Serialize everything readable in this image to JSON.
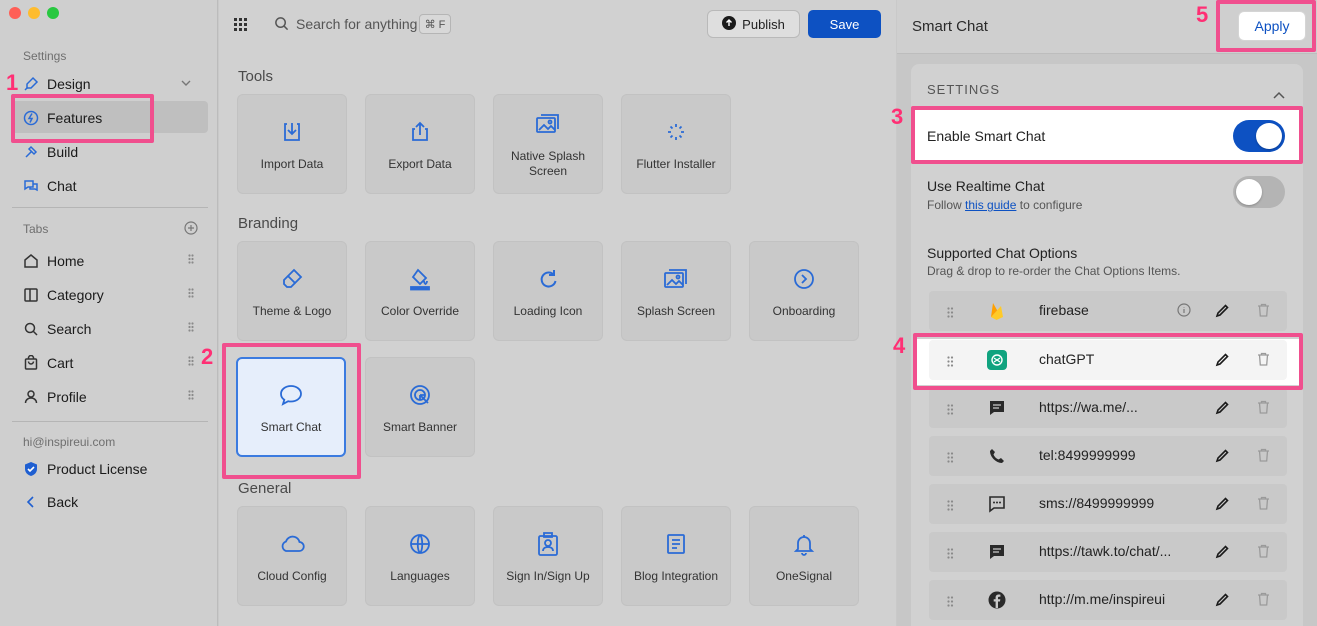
{
  "sidebar": {
    "settings_heading": "Settings",
    "items": [
      {
        "label": "Design",
        "icon": "paintbrush-icon"
      },
      {
        "label": "Features",
        "icon": "lightning-icon"
      },
      {
        "label": "Build",
        "icon": "hammer-icon"
      },
      {
        "label": "Chat",
        "icon": "chat-bubbles-icon"
      }
    ],
    "tabs_heading": "Tabs",
    "tabs": [
      {
        "label": "Home",
        "icon": "home-icon"
      },
      {
        "label": "Category",
        "icon": "category-icon"
      },
      {
        "label": "Search",
        "icon": "search-icon"
      },
      {
        "label": "Cart",
        "icon": "cart-icon"
      },
      {
        "label": "Profile",
        "icon": "profile-icon"
      }
    ],
    "email": "hi@inspireui.com",
    "product_license": "Product License",
    "back": "Back"
  },
  "toolbar": {
    "search_placeholder": "Search for anything",
    "shortcut": "⌘ F",
    "publish_label": "Publish",
    "save_label": "Save"
  },
  "sections": {
    "tools": {
      "title": "Tools",
      "cards": [
        "Import Data",
        "Export Data",
        "Native Splash Screen",
        "Flutter Installer"
      ]
    },
    "branding": {
      "title": "Branding",
      "cards": [
        "Theme & Logo",
        "Color Override",
        "Loading Icon",
        "Splash Screen",
        "Onboarding",
        "Smart Chat",
        "Smart Banner"
      ]
    },
    "general": {
      "title": "General",
      "cards": [
        "Cloud Config",
        "Languages",
        "Sign In/Sign Up",
        "Blog Integration",
        "OneSignal"
      ]
    }
  },
  "right_panel": {
    "title": "Smart Chat",
    "apply_label": "Apply",
    "settings_heading": "SETTINGS",
    "enable_label": "Enable Smart Chat",
    "enable_on": true,
    "realtime_label": "Use Realtime Chat",
    "realtime_on": false,
    "realtime_help_prefix": "Follow",
    "realtime_help_link": "this guide",
    "realtime_help_suffix": "to configure",
    "options_heading": "Supported Chat Options",
    "options_help": "Drag & drop to re-order the Chat Options Items.",
    "options": [
      {
        "label": "firebase",
        "icon": "firebase-icon"
      },
      {
        "label": "chatGPT",
        "icon": "chatgpt-icon"
      },
      {
        "label": "https://wa.me/...",
        "icon": "message-icon"
      },
      {
        "label": "tel:8499999999",
        "icon": "phone-icon"
      },
      {
        "label": "sms://8499999999",
        "icon": "sms-icon"
      },
      {
        "label": "https://tawk.to/chat/...",
        "icon": "message-icon"
      },
      {
        "label": "http://m.me/inspireui",
        "icon": "facebook-icon"
      }
    ]
  },
  "annotations": [
    "1",
    "2",
    "3",
    "4",
    "5"
  ],
  "colors": {
    "accent": "#0d51c2",
    "highlight": "#f04f8e",
    "annotation_number": "#ff2f74",
    "toggle_on": "#0d51c2"
  }
}
